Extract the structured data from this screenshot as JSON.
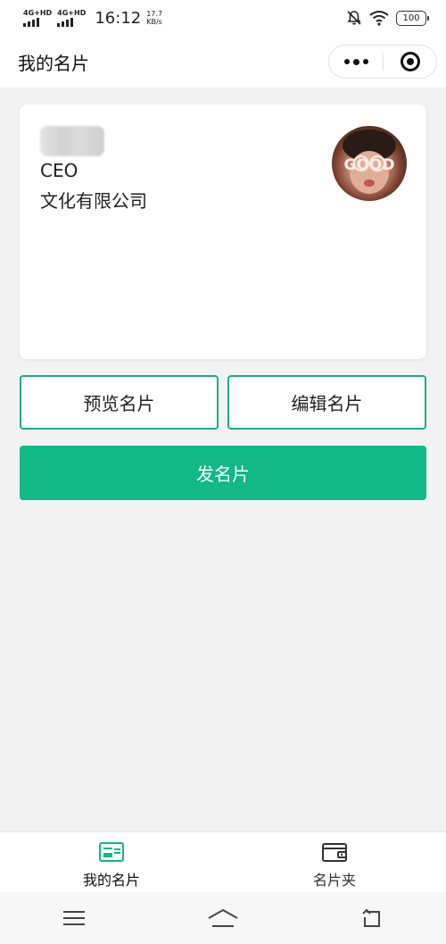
{
  "status_bar": {
    "network_1": "4G+HD",
    "network_2": "4G+HD",
    "time": "16:12",
    "speed_value": "17.7",
    "speed_unit": "KB/s",
    "battery": "100",
    "icons": [
      "signal-icon",
      "signal-icon",
      "mute-icon",
      "wifi-icon",
      "battery-icon"
    ]
  },
  "header": {
    "title": "我的名片"
  },
  "card": {
    "job_title": "CEO",
    "company": "文化有限公司",
    "avatar_text": "GOOD"
  },
  "actions": {
    "preview_label": "预览名片",
    "edit_label": "编辑名片",
    "send_label": "发名片"
  },
  "tabs": [
    {
      "label": "我的名片",
      "icon": "card-icon",
      "active": true
    },
    {
      "label": "名片夹",
      "icon": "wallet-icon",
      "active": false
    }
  ],
  "nav": {
    "icons": [
      "menu-icon",
      "home-icon",
      "back-icon"
    ]
  },
  "colors": {
    "accent": "#12b886",
    "outline": "#1aad87",
    "background": "#f2f2f2"
  }
}
